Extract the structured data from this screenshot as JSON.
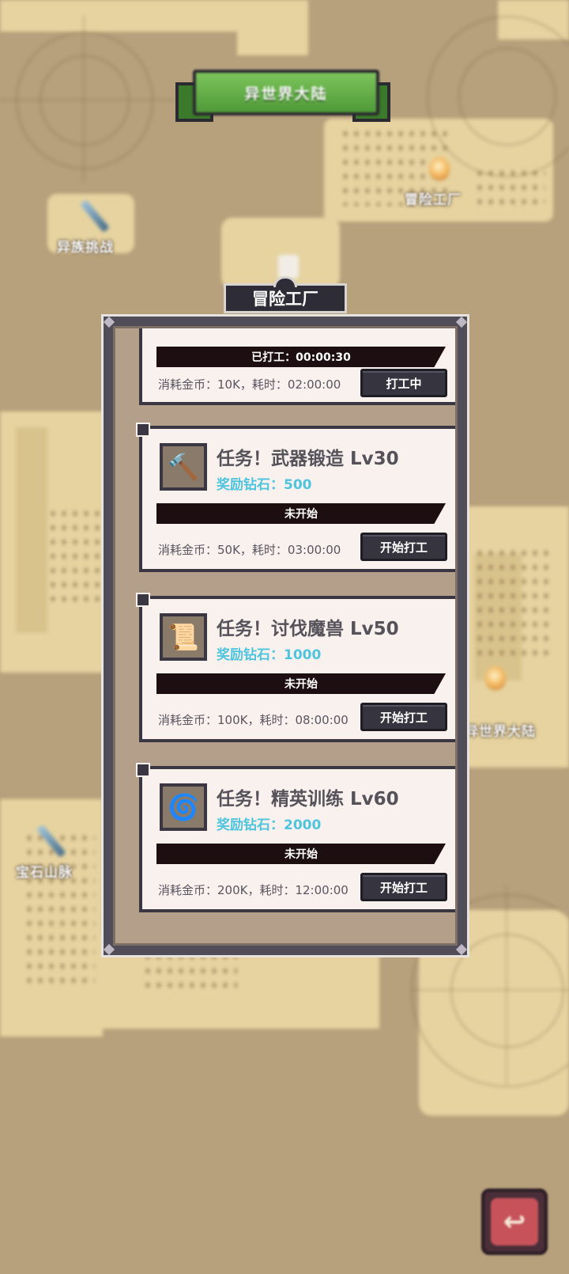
{
  "map": {
    "banner_title": "异世界大陆",
    "locations": [
      {
        "label": "冒险工厂"
      },
      {
        "label": "异族挑战"
      },
      {
        "label": "异世界大陆"
      },
      {
        "label": "宝石山脉"
      }
    ]
  },
  "panel": {
    "title": "冒险工厂",
    "active_job": {
      "status": "已打工：00:00:30",
      "cost": "消耗金币：10K，耗时：02:00:00",
      "button": "打工中"
    },
    "tasks": [
      {
        "icon": "hammer-scroll-icon",
        "title": "任务！武器锻造 Lv30",
        "reward": "奖励钻石：500",
        "status": "未开始",
        "cost": "消耗金币：50K，耗时：03:00:00",
        "button": "开始打工"
      },
      {
        "icon": "beast-scroll-icon",
        "title": "任务！讨伐魔兽 Lv50",
        "reward": "奖励钻石：1000",
        "status": "未开始",
        "cost": "消耗金币：100K，耗时：08:00:00",
        "button": "开始打工"
      },
      {
        "icon": "training-scroll-icon",
        "title": "任务！精英训练 Lv60",
        "reward": "奖励钻石：2000",
        "status": "未开始",
        "cost": "消耗金币：200K，耗时：12:00:00",
        "button": "开始打工"
      }
    ]
  },
  "back_button": {
    "icon": "return-arrow-icon"
  },
  "colors": {
    "map_bg": "#b7a07c",
    "land": "#e6d3a0",
    "panel_frame": "#514d58",
    "card_bg": "#f9f1ee",
    "reward_text": "#4ec4df",
    "progress_bar": "#1d0e12",
    "button_bg": "#36343f",
    "banner_green": "#5fae45"
  }
}
